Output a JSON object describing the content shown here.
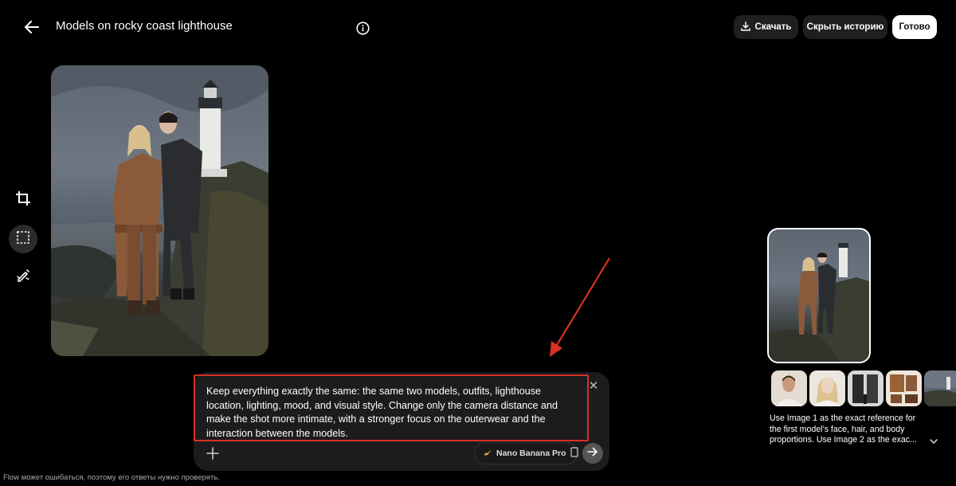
{
  "header": {
    "title": "Models on rocky coast lighthouse",
    "download_label": "Скачать",
    "hide_history_label": "Скрыть историю",
    "done_label": "Готово"
  },
  "icons": {
    "back": "back-arrow-icon",
    "info": "info-icon",
    "download": "download-icon",
    "crop": "crop-icon",
    "select": "selection-icon",
    "brush": "brush-icon",
    "close": "close-icon",
    "add": "plus-icon",
    "model": "banana-icon",
    "aspect": "portrait-ratio-icon",
    "send": "send-arrow-icon",
    "expand": "chevron-down-icon"
  },
  "toolbar": {
    "active_tool": "select"
  },
  "prompt": {
    "text": "Keep everything exactly the same: the same two models, outfits, lighthouse location, lighting, mood, and visual style. Change only the camera distance and make the shot more intimate, with a stronger focus on the outerwear and the interaction between the models.",
    "model_name": "Nano Banana Pro"
  },
  "history": {
    "reference_count": 5,
    "reference_description": "Use Image 1 as the exact reference for the first model’s face, hair, and body proportions. Use Image 2 as the exac..."
  },
  "footer": {
    "disclaimer": "Flow может ошибаться, поэтому его ответы нужно проверять."
  },
  "colors": {
    "background": "#000000",
    "panel": "#1c1c1e",
    "highlight_border": "#d93025",
    "annotation_arrow": "#d93025",
    "done_button": "#ffffff"
  }
}
